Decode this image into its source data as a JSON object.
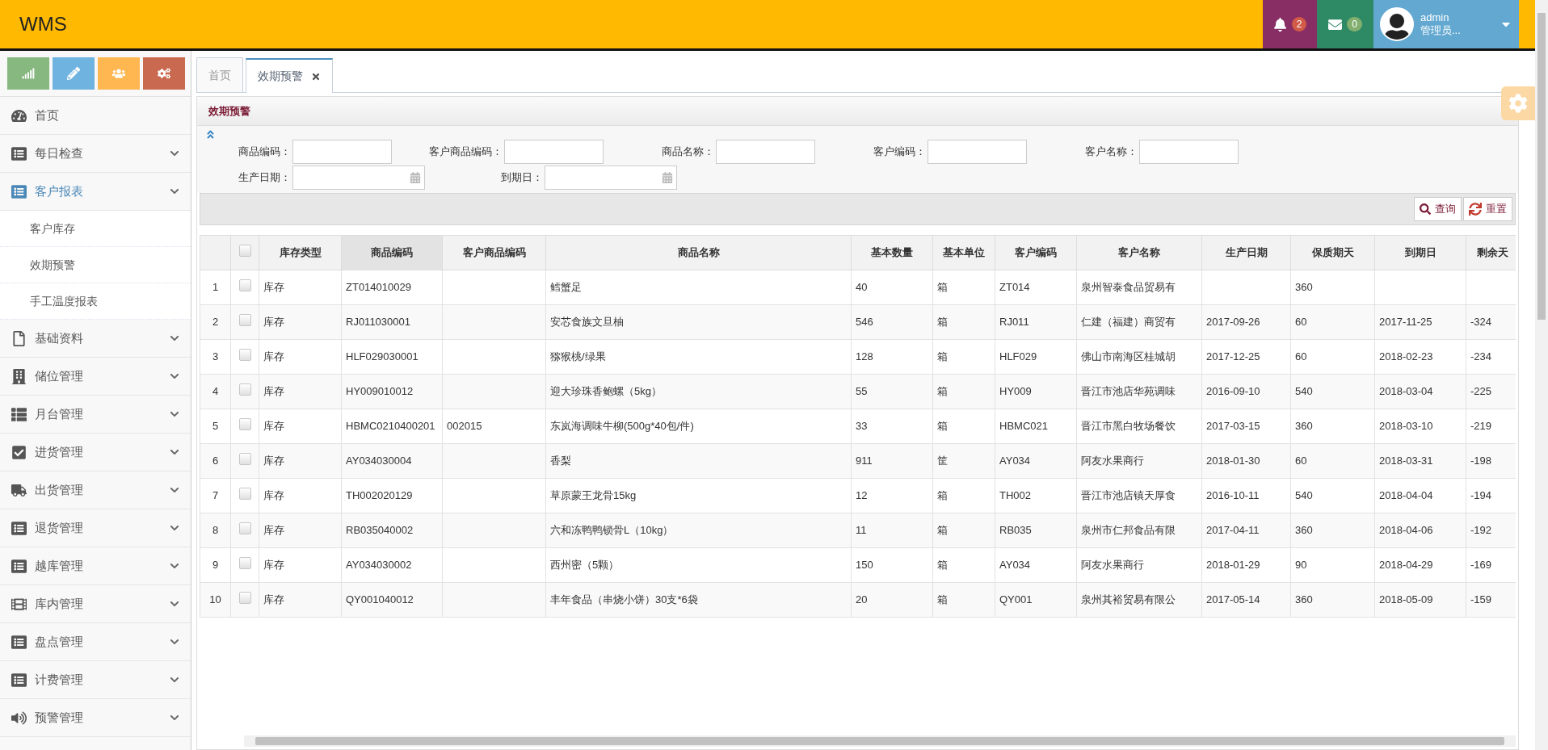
{
  "header": {
    "logo": "WMS",
    "notifications": {
      "count": "2"
    },
    "messages": {
      "count": "0"
    },
    "user": {
      "name": "admin",
      "role": "管理员..."
    }
  },
  "shortcuts": [
    {
      "color": "#87b87f"
    },
    {
      "color": "#6fb3e0"
    },
    {
      "color": "#ffb752"
    },
    {
      "color": "#c9694f"
    }
  ],
  "sidebar": {
    "items": [
      {
        "label": "首页",
        "expandable": false,
        "expanded": false
      },
      {
        "label": "每日检查",
        "expandable": true,
        "expanded": false
      },
      {
        "label": "客户报表",
        "expandable": true,
        "expanded": true,
        "children": [
          {
            "label": "客户库存"
          },
          {
            "label": "效期预警"
          },
          {
            "label": "手工温度报表"
          }
        ]
      },
      {
        "label": "基础资料",
        "expandable": true,
        "expanded": false
      },
      {
        "label": "储位管理",
        "expandable": true,
        "expanded": false
      },
      {
        "label": "月台管理",
        "expandable": true,
        "expanded": false
      },
      {
        "label": "进货管理",
        "expandable": true,
        "expanded": false
      },
      {
        "label": "出货管理",
        "expandable": true,
        "expanded": false
      },
      {
        "label": "退货管理",
        "expandable": true,
        "expanded": false
      },
      {
        "label": "越库管理",
        "expandable": true,
        "expanded": false
      },
      {
        "label": "库内管理",
        "expandable": true,
        "expanded": false
      },
      {
        "label": "盘点管理",
        "expandable": true,
        "expanded": false
      },
      {
        "label": "计费管理",
        "expandable": true,
        "expanded": false
      },
      {
        "label": "预警管理",
        "expandable": true,
        "expanded": false
      }
    ]
  },
  "tabs": [
    {
      "label": "首页",
      "selected": false,
      "closable": false
    },
    {
      "label": "效期预警",
      "selected": true,
      "closable": true
    }
  ],
  "panel": {
    "title": "效期预警"
  },
  "filters": [
    {
      "label": "商品编码：",
      "kind": "text"
    },
    {
      "label": "客户商品编码：",
      "kind": "text"
    },
    {
      "label": "商品名称：",
      "kind": "text"
    },
    {
      "label": "客户编码：",
      "kind": "text"
    },
    {
      "label": "客户名称：",
      "kind": "text"
    },
    {
      "label": "生产日期：",
      "kind": "date"
    },
    {
      "label": "到期日：",
      "kind": "date"
    }
  ],
  "buttons": [
    {
      "label": "查询",
      "kind": "search"
    },
    {
      "label": "重置",
      "kind": "reset"
    }
  ],
  "table": {
    "all_checked": false,
    "columns": [
      {
        "label": "库存类型",
        "sorted": false
      },
      {
        "label": "商品编码",
        "sorted": true
      },
      {
        "label": "客户商品编码",
        "sorted": false
      },
      {
        "label": "商品名称",
        "sorted": false
      },
      {
        "label": "基本数量",
        "sorted": false
      },
      {
        "label": "基本单位",
        "sorted": false
      },
      {
        "label": "客户编码",
        "sorted": false
      },
      {
        "label": "客户名称",
        "sorted": false
      },
      {
        "label": "生产日期",
        "sorted": false
      },
      {
        "label": "保质期天",
        "sorted": false
      },
      {
        "label": "到期日",
        "sorted": false
      },
      {
        "label": "剩余天",
        "sorted": false
      }
    ],
    "rows": [
      {
        "index": "1",
        "checked": false,
        "cells": [
          "库存",
          "ZT014010029",
          "",
          "鳕蟹足",
          "40",
          "箱",
          "ZT014",
          "泉州智泰食品贸易有",
          "",
          "360",
          "",
          ""
        ]
      },
      {
        "index": "2",
        "checked": false,
        "cells": [
          "库存",
          "RJ011030001",
          "",
          "安芯食族文旦柚",
          "546",
          "箱",
          "RJ011",
          "仁建（福建）商贸有",
          "2017-09-26",
          "60",
          "2017-11-25",
          "-324"
        ]
      },
      {
        "index": "3",
        "checked": false,
        "cells": [
          "库存",
          "HLF029030001",
          "",
          "猕猴桃/绿果",
          "128",
          "箱",
          "HLF029",
          "佛山市南海区桂城胡",
          "2017-12-25",
          "60",
          "2018-02-23",
          "-234"
        ]
      },
      {
        "index": "4",
        "checked": false,
        "cells": [
          "库存",
          "HY009010012",
          "",
          "迎大珍珠香鲍螺（5kg）",
          "55",
          "箱",
          "HY009",
          "晋江市池店华苑调味",
          "2016-09-10",
          "540",
          "2018-03-04",
          "-225"
        ]
      },
      {
        "index": "5",
        "checked": false,
        "cells": [
          "库存",
          "HBMC0210400201",
          "002015",
          "东岚海调味牛柳(500g*40包/件)",
          "33",
          "箱",
          "HBMC021",
          "晋江市黑白牧场餐饮",
          "2017-03-15",
          "360",
          "2018-03-10",
          "-219"
        ]
      },
      {
        "index": "6",
        "checked": false,
        "cells": [
          "库存",
          "AY034030004",
          "",
          "香梨",
          "911",
          "筐",
          "AY034",
          "阿友水果商行",
          "2018-01-30",
          "60",
          "2018-03-31",
          "-198"
        ]
      },
      {
        "index": "7",
        "checked": false,
        "cells": [
          "库存",
          "TH002020129",
          "",
          "草原蒙王龙骨15kg",
          "12",
          "箱",
          "TH002",
          "晋江市池店镇天厚食",
          "2016-10-11",
          "540",
          "2018-04-04",
          "-194"
        ]
      },
      {
        "index": "8",
        "checked": false,
        "cells": [
          "库存",
          "RB035040002",
          "",
          "六和冻鸭鸭锁骨L（10kg）",
          "11",
          "箱",
          "RB035",
          "泉州市仁邦食品有限",
          "2017-04-11",
          "360",
          "2018-04-06",
          "-192"
        ]
      },
      {
        "index": "9",
        "checked": false,
        "cells": [
          "库存",
          "AY034030002",
          "",
          "西州密（5颗）",
          "150",
          "箱",
          "AY034",
          "阿友水果商行",
          "2018-01-29",
          "90",
          "2018-04-29",
          "-169"
        ]
      },
      {
        "index": "10",
        "checked": false,
        "cells": [
          "库存",
          "QY001040012",
          "",
          "丰年食品（串烧小饼）30支*6袋",
          "20",
          "箱",
          "QY001",
          "泉州其裕贸易有限公",
          "2017-05-14",
          "360",
          "2018-05-09",
          "-159"
        ]
      }
    ]
  }
}
